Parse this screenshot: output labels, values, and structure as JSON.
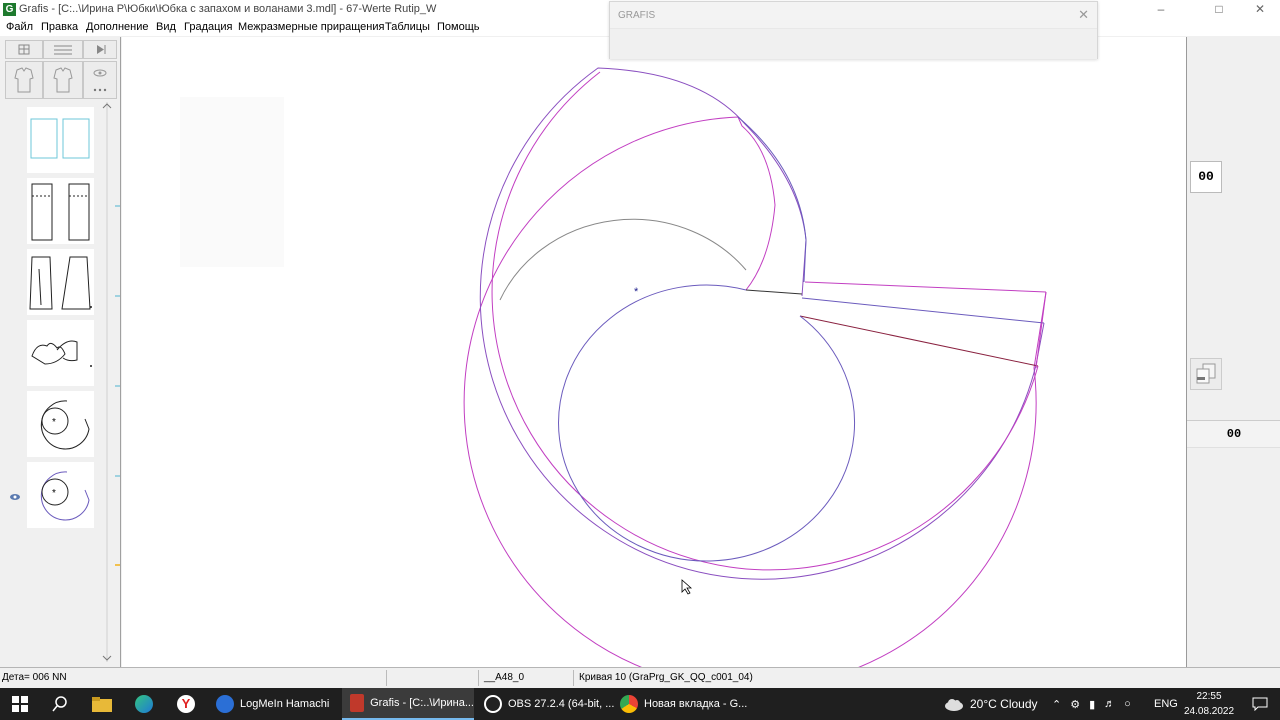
{
  "window": {
    "title": "Grafis - [C:..\\Ирина Р\\Юбки\\Юбка с запахом и воланами 3.mdl] - 67-Werte Rutip_W",
    "app_icon": "G"
  },
  "menu": [
    "Файл",
    "Правка",
    "Дополнение",
    "Вид",
    "Градация",
    "Межразмерные приращения",
    "Таблицы",
    "Помощь"
  ],
  "dialog": {
    "title": "GRAFIS"
  },
  "right_panel": {
    "value_top": "00",
    "value_bottom": "00"
  },
  "status": {
    "detail": "Дета= 006  NN",
    "size": "__A48_0",
    "curve": "Кривая 10 (GraPrg_GK_QQ_c001_04)"
  },
  "taskbar": {
    "items": [
      {
        "label": "LogMeIn Hamachi",
        "color": "#2b6fd6"
      },
      {
        "label": "Grafis - [C:..\\Ирина...",
        "color": "#c0392b"
      },
      {
        "label": "OBS 27.2.4 (64-bit, ...",
        "color": "#222222"
      },
      {
        "label": "Новая вкладка - G...",
        "color": "#4285f4"
      }
    ],
    "weather": "20°C  Cloudy",
    "language": "ENG",
    "time": "22:55",
    "date": "24.08.2022"
  },
  "colors": {
    "magenta": "#c23fc2",
    "purple": "#6b5bbd",
    "wine": "#8a2240",
    "grey": "#666666"
  }
}
